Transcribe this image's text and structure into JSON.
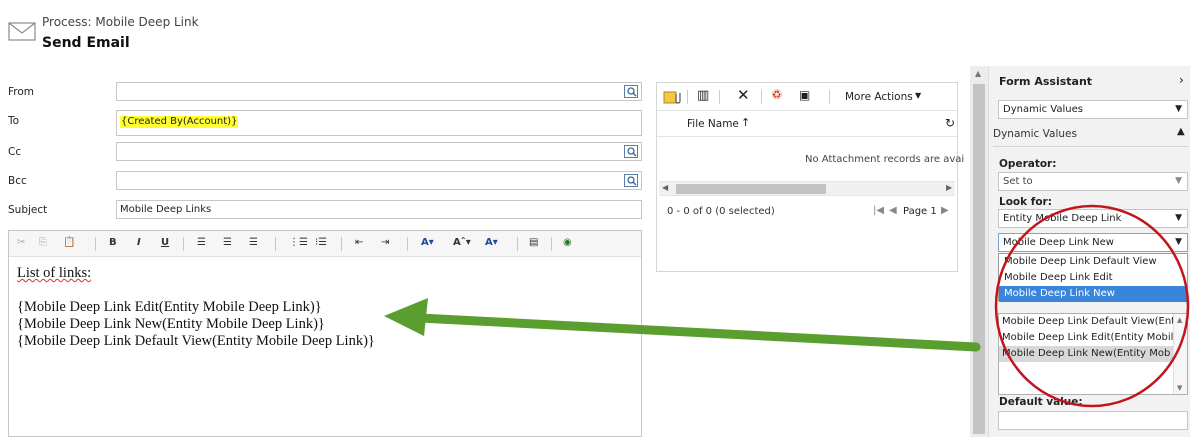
{
  "header": {
    "subtitle": "Process: Mobile Deep Link",
    "title": "Send Email"
  },
  "form": {
    "from_label": "From",
    "from_value": "",
    "to_label": "To",
    "to_value": "{Created By(Account)}",
    "cc_label": "Cc",
    "cc_value": "",
    "bcc_label": "Bcc",
    "bcc_value": "",
    "subject_label": "Subject",
    "subject_value": "Mobile Deep Links"
  },
  "editor": {
    "lines": [
      "List of links:",
      "{Mobile Deep Link Edit(Entity Mobile Deep Link)}",
      "{Mobile Deep Link New(Entity Mobile Deep Link)}",
      "{Mobile Deep Link Default View(Entity Mobile Deep Link)}"
    ]
  },
  "attachments": {
    "more_actions": "More Actions",
    "column_file_name": "File Name",
    "empty_message": "No Attachment records are avai",
    "range": "0 - 0 of 0 (0 selected)",
    "page": "Page 1"
  },
  "assistant": {
    "title": "Form Assistant",
    "top_select": "Dynamic Values",
    "section_title": "Dynamic Values",
    "operator_label": "Operator:",
    "operator_value": "Set to",
    "look_for_label": "Look for:",
    "look_for_value": "Entity Mobile Deep Link",
    "dropdown_value": "Mobile Deep Link New",
    "dropdown_options": [
      "Mobile Deep Link Default View",
      "Mobile Deep Link Edit",
      "Mobile Deep Link New"
    ],
    "selected_values": [
      "Mobile Deep Link Default View(Ent",
      "Mobile Deep Link Edit(Entity Mobil",
      "Mobile Deep Link New(Entity Mob"
    ],
    "default_value_label": "Default value:"
  },
  "colors": {
    "annotation_arrow": "#5a9e2f",
    "annotation_circle": "#c0161c",
    "highlight": "#ffff33",
    "selected_option": "#3a85d9"
  }
}
